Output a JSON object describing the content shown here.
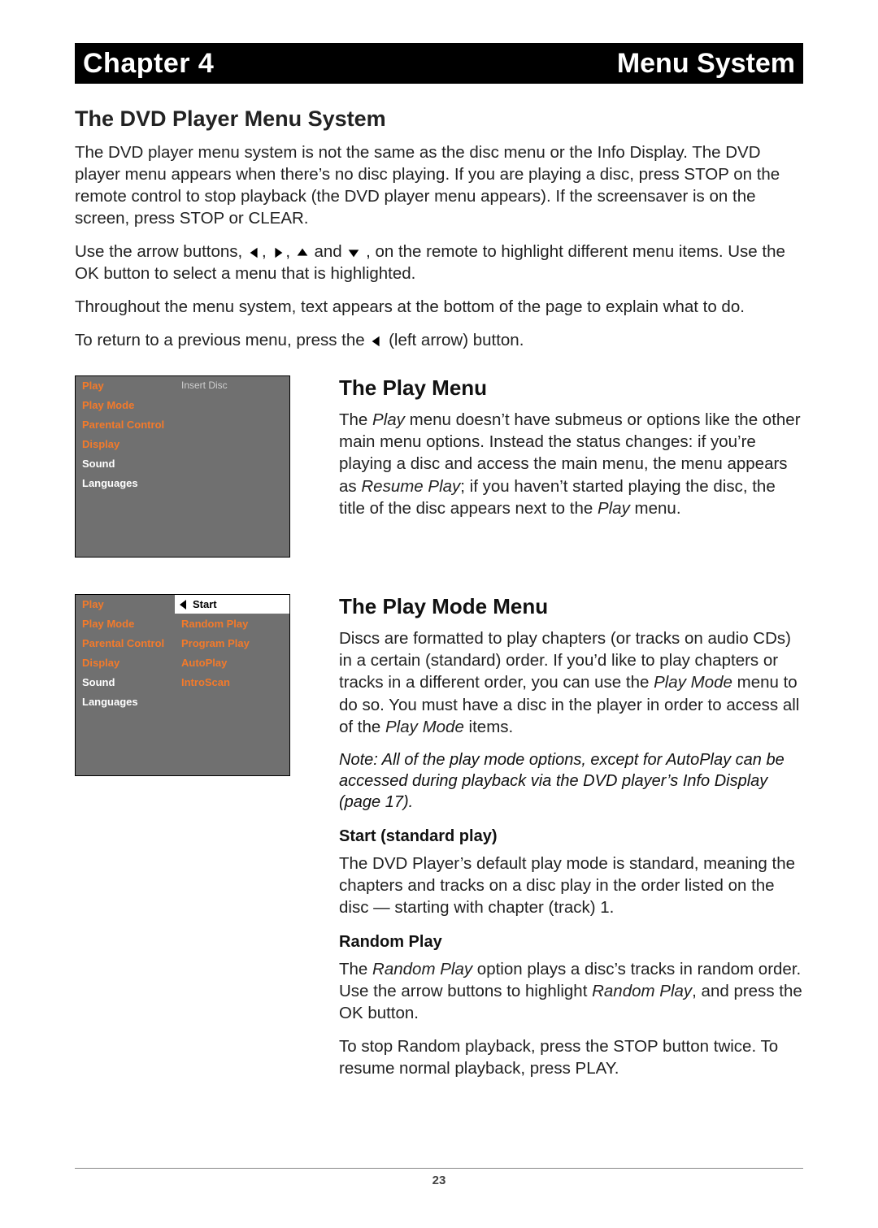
{
  "header": {
    "chapter_label": "Chapter 4",
    "system_label": "Menu System"
  },
  "section_title": "The DVD Player Menu System",
  "paragraphs": {
    "p1": "The DVD player menu system is not the same as the disc menu or the Info Display. The DVD player menu appears when there’s no disc playing. If you are playing a disc, press STOP on the remote control to stop playback (the DVD player menu appears). If the screensaver is on the screen, press STOP or CLEAR.",
    "p2_a": "Use the arrow buttons, ",
    "p2_b": " , on the remote to highlight different menu items. Use the OK button to select a menu that is highlighted.",
    "p2_and": " and ",
    "p3": "Throughout the menu system, text appears at the bottom of the page to explain what to do.",
    "p4_a": "To return to a previous menu, press the ",
    "p4_b": " (left arrow) button."
  },
  "menu1": {
    "left": [
      "Play",
      "Play Mode",
      "Parental Control",
      "Display",
      "Sound",
      "Languages"
    ],
    "right_status": "Insert Disc"
  },
  "menu2": {
    "left": [
      "Play",
      "Play Mode",
      "Parental Control",
      "Display",
      "Sound",
      "Languages"
    ],
    "right": [
      "Start",
      "Random Play",
      "Program Play",
      "AutoPlay",
      "IntroScan"
    ]
  },
  "play_menu": {
    "title": "The Play Menu",
    "body_a": "The ",
    "body_i1": "Play",
    "body_b": " menu doesn’t have submeus or options like the other main menu options. Instead the status changes: if you’re playing a disc and access the main menu, the menu appears as ",
    "body_i2": "Resume Play",
    "body_c": "; if you haven’t started playing the disc, the title of the disc appears next to the ",
    "body_i3": "Play",
    "body_d": " menu."
  },
  "play_mode": {
    "title": "The Play Mode Menu",
    "body_a": "Discs are formatted to play chapters (or tracks on audio CDs) in a certain (standard) order. If you’d like to play chapters or tracks in a different order, you can use the ",
    "body_i1": "Play Mode",
    "body_b": " menu to do so. You must have a disc in the player in order to access all of the ",
    "body_i2": "Play Mode",
    "body_c": " items.",
    "note": "Note: All of the play mode options, except for AutoPlay can be accessed during playback via the DVD player’s Info Display (page 17).",
    "start_title": "Start (standard play)",
    "start_body": "The DVD Player’s default play mode is standard, meaning the chapters and tracks on a disc play in the order listed on the disc — starting with chapter (track) 1.",
    "random_title": "Random Play",
    "random_a": "The ",
    "random_i1": "Random Play",
    "random_b": " option plays a disc’s tracks in random order. Use the arrow buttons to highlight ",
    "random_i2": "Random Play",
    "random_c": ", and press the OK button.",
    "random_p2": "To stop Random playback, press the STOP button twice. To resume normal playback, press PLAY."
  },
  "footer": {
    "page_number": "23"
  }
}
